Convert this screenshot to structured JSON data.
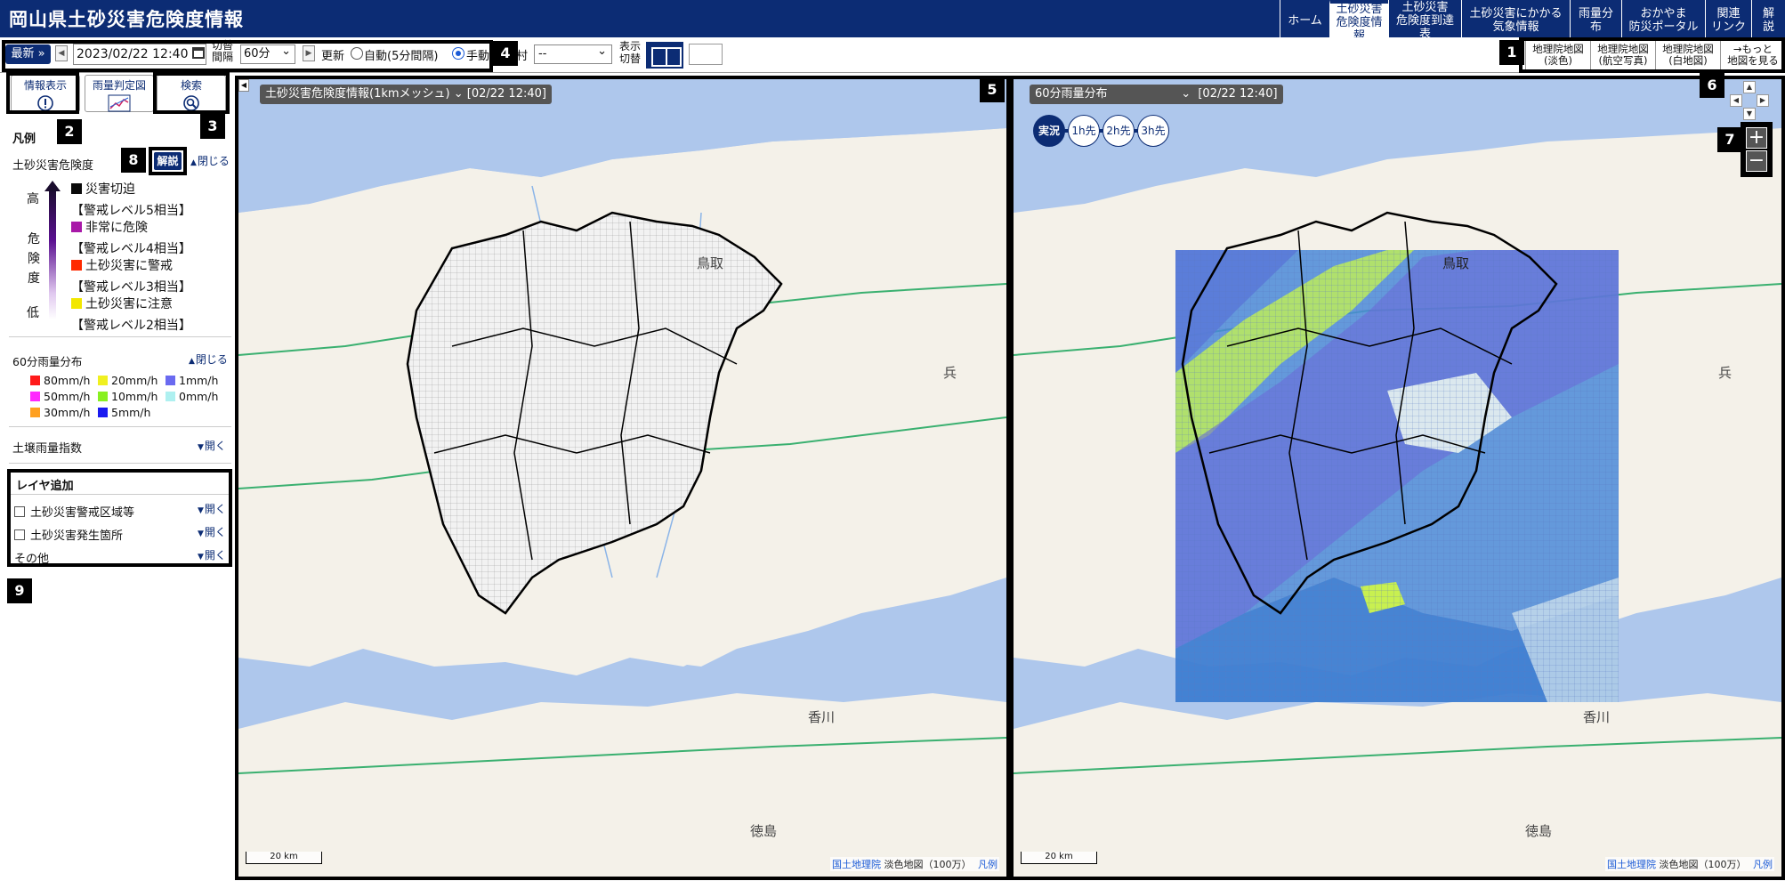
{
  "header": {
    "title": "岡山県土砂災害危険度情報",
    "nav": [
      {
        "label": "ホーム"
      },
      {
        "label": "土砂災害\n危険度情報",
        "active": true
      },
      {
        "label": "土砂災害\n危険度到達表"
      },
      {
        "label": "土砂災害にかかる\n気象情報"
      },
      {
        "label": "雨量分布"
      },
      {
        "label": "おかやま\n防災ポータル"
      },
      {
        "label": "関連\nリンク"
      },
      {
        "label": "解説"
      }
    ]
  },
  "toolbar": {
    "latest_label": "最新 »",
    "datetime": "2023/02/22 12:40",
    "interval_label": "切替間隔",
    "interval_value": "60分",
    "update_label": "更新",
    "auto_label": "自動(5分間隔)",
    "manual_label": "手動",
    "city_label": "村",
    "city_value": "--",
    "view_switch_label": "表示\n切替",
    "basemaps": [
      {
        "label": "地理院地図\n(淡色)"
      },
      {
        "label": "地理院地図\n(航空写真)"
      },
      {
        "label": "地理院地図\n(白地図)"
      },
      {
        "label": "→もっと\n地図を見る"
      }
    ]
  },
  "panel": {
    "tabs": [
      {
        "label": "情報表示",
        "icon": "info-icon"
      },
      {
        "label": "雨量判定図",
        "icon": "chart-icon"
      },
      {
        "label": "検索",
        "icon": "search-icon"
      }
    ],
    "legend_heading": "凡例",
    "hazard_title": "土砂災害危険度",
    "explain_label": "解説",
    "close_label": "閉じる",
    "open_label": "開く",
    "scale_high": "高",
    "scale_danger": "危険度",
    "scale_low": "低",
    "hazard_levels": [
      {
        "label": "災害切迫",
        "sub": "【警戒レベル5相当】",
        "color": "#0a0a0a"
      },
      {
        "label": "非常に危険",
        "sub": "【警戒レベル4相当】",
        "color": "#a818a8"
      },
      {
        "label": "土砂災害に警戒",
        "sub": "【警戒レベル3相当】",
        "color": "#ff2a00"
      },
      {
        "label": "土砂災害に注意",
        "sub": "【警戒レベル2相当】",
        "color": "#f2e700"
      }
    ],
    "rain_title": "60分雨量分布",
    "rain_levels": [
      {
        "label": "80mm/h",
        "color": "#ff1a1a"
      },
      {
        "label": "20mm/h",
        "color": "#f0f020"
      },
      {
        "label": "1mm/h",
        "color": "#6a6af0"
      },
      {
        "label": "50mm/h",
        "color": "#ff28ff"
      },
      {
        "label": "10mm/h",
        "color": "#88f020"
      },
      {
        "label": "0mm/h",
        "color": "#aef0f0"
      },
      {
        "label": "30mm/h",
        "color": "#ffa020"
      },
      {
        "label": "5mm/h",
        "color": "#1a1af0"
      }
    ],
    "soil_title": "土壌雨量指数",
    "layer_heading": "レイヤ追加",
    "layers": [
      {
        "label": "土砂災害警戒区域等"
      },
      {
        "label": "土砂災害発生箇所"
      },
      {
        "label": "その他"
      }
    ]
  },
  "map_left": {
    "header": "土砂災害危険度情報(1kmメッシュ) ⌄  [02/22 12:40]",
    "scale": "20 km",
    "attrib_gsi": "国土地理院",
    "attrib_text": "淡色地図（100万）",
    "attrib_legend": "凡例"
  },
  "map_right": {
    "header": "60分雨量分布                    ⌄  [02/22 12:40]",
    "modes": [
      "実況",
      "1h先",
      "2h先",
      "3h先"
    ],
    "scale": "20 km",
    "attrib_gsi": "国土地理院",
    "attrib_text": "淡色地図（100万）",
    "attrib_legend": "凡例"
  },
  "markers": [
    "1",
    "2",
    "3",
    "4",
    "5",
    "6",
    "7",
    "8",
    "9"
  ],
  "place_labels": {
    "tottori": "鳥取",
    "hyogo": "兵",
    "kagawa": "香川",
    "tokushima": "徳島"
  }
}
